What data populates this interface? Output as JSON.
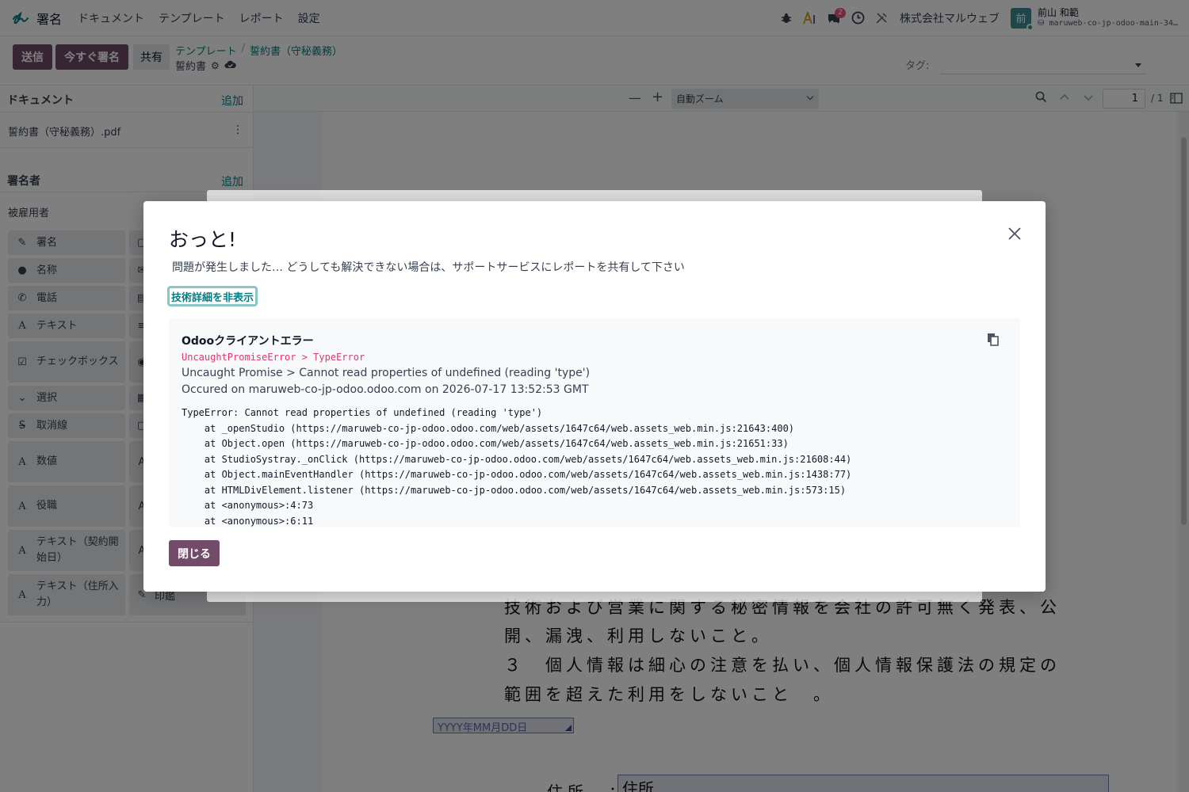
{
  "navbar": {
    "app_name": "署名",
    "menu": [
      "ドキュメント",
      "テンプレート",
      "レポート",
      "設定"
    ],
    "messages_count": "2",
    "company": "株式会社マルウェブ",
    "avatar_initial": "前",
    "user_name": "前山 和範",
    "database": "maruweb-co-jp-odoo-main-34…"
  },
  "control": {
    "send": "送信",
    "sign_now": "今すぐ署名",
    "share": "共有",
    "breadcrumb": [
      "テンプレート",
      "誓約書（守秘義務）"
    ],
    "record_name": "誓約書",
    "tags_label": "タグ:"
  },
  "sidebar": {
    "documents_title": "ドキュメント",
    "documents_add": "追加",
    "document_file": "誓約書（守秘義務）.pdf",
    "signers_title": "署名者",
    "signers_add": "追加",
    "role": "被雇用者",
    "fields": [
      {
        "label": "署名",
        "icon": "edit-icon"
      },
      {
        "label": "名称",
        "icon": "user-icon"
      },
      {
        "label": "電話",
        "icon": "phone-icon"
      },
      {
        "label": "テキスト",
        "icon": "text-icon"
      },
      {
        "label": "チェックボックス",
        "icon": "checkbox-icon"
      },
      {
        "label": "選択",
        "icon": "chevron-down-icon"
      },
      {
        "label": "取消線",
        "icon": "strikethrough-icon"
      },
      {
        "label": "数値",
        "icon": "text-icon"
      },
      {
        "label": "役職",
        "icon": "text-icon"
      },
      {
        "label": "テキスト（契約開始日）",
        "icon": "text-icon"
      },
      {
        "label": "テキスト（住所入力）",
        "icon": "text-icon"
      }
    ],
    "stamp_label": "印鑑"
  },
  "viewer": {
    "zoom": "自動ズーム",
    "page_current": "1",
    "page_total": "/ 1",
    "doc_lines": [
      "技術および営業に関する秘密情報を会社の許可無く発表、公",
      "開、漏洩、利用しないこと。",
      "３　個人情報は細心の注意を払い、個人情報保護法の規定の",
      "範囲を超えた利用をしないこと　。"
    ],
    "date_placeholder": "YYYY年MM月DD日",
    "address_label": "住所　：",
    "address_field": "住所"
  },
  "dialog": {
    "title": "おっと!",
    "message": "問題が発生しました… どうしても解決できない場合は、サポートサービスにレポートを共有して下さい",
    "toggle_details": "技術詳細を非表示",
    "error_title": "Odooクライアントエラー",
    "error_type": "UncaughtPromiseError > TypeError",
    "error_summary": "Uncaught Promise > Cannot read properties of undefined (reading 'type')",
    "error_occurred": "Occured on maruweb-co-jp-odoo.odoo.com on 2026-07-17 13:52:53 GMT",
    "traceback": [
      "TypeError: Cannot read properties of undefined (reading 'type')",
      "    at _openStudio (https://maruweb-co-jp-odoo.odoo.com/web/assets/1647c64/web.assets_web.min.js:21643:400)",
      "    at Object.open (https://maruweb-co-jp-odoo.odoo.com/web/assets/1647c64/web.assets_web.min.js:21651:33)",
      "    at StudioSystray._onClick (https://maruweb-co-jp-odoo.odoo.com/web/assets/1647c64/web.assets_web.min.js:21608:44)",
      "    at Object.mainEventHandler (https://maruweb-co-jp-odoo.odoo.com/web/assets/1647c64/web.assets_web.min.js:1438:77)",
      "    at HTMLDivElement.listener (https://maruweb-co-jp-odoo.odoo.com/web/assets/1647c64/web.assets_web.min.js:573:15)",
      "    at <anonymous>:4:73",
      "    at <anonymous>:6:11"
    ],
    "close_button": "閉じる"
  },
  "colors": {
    "primary": "#714b67",
    "link": "#017e84",
    "error_type": "#d63a6f"
  }
}
